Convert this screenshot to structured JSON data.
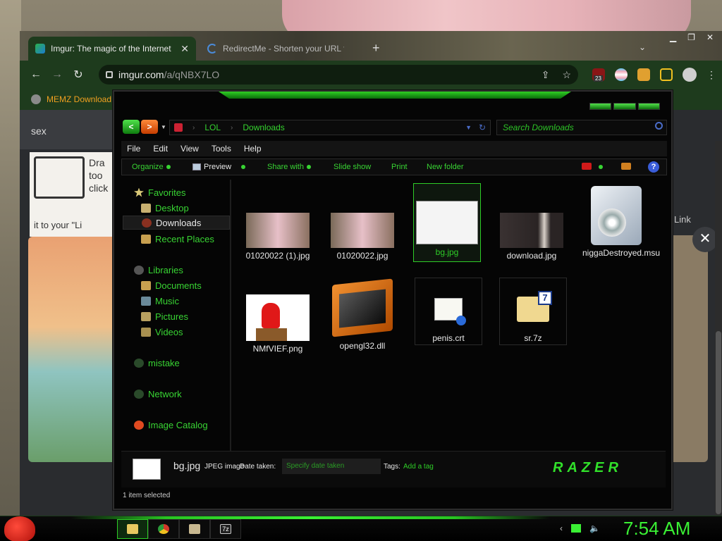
{
  "browser": {
    "tabs": [
      {
        "title": "Imgur: The magic of the Internet",
        "active": true
      },
      {
        "title": "RedirectMe - Shorten your URL f",
        "active": false
      }
    ],
    "new_tab": "+",
    "url_host": "imgur.com",
    "url_path": "/a/qNBX7LO",
    "bookmarks": [
      {
        "label": "MEMZ Download"
      }
    ],
    "extension_badge": "23"
  },
  "page": {
    "search_text": "sex",
    "card_text": "it to your \"Li",
    "card_side_text": [
      "Dra",
      "too",
      "click"
    ],
    "link_label": "Link",
    "close": "✕"
  },
  "explorer": {
    "address": [
      "LOL",
      "Downloads"
    ],
    "search_placeholder": "Search Downloads",
    "menu": [
      "File",
      "Edit",
      "View",
      "Tools",
      "Help"
    ],
    "commands": [
      "Organize",
      "Preview",
      "Share with",
      "Slide show",
      "Print",
      "New folder"
    ],
    "sidebar": {
      "favorites": "Favorites",
      "desktop": "Desktop",
      "downloads": "Downloads",
      "recent": "Recent Places",
      "libraries": "Libraries",
      "documents": "Documents",
      "music": "Music",
      "pictures": "Pictures",
      "videos": "Videos",
      "mistake": "mistake",
      "network": "Network",
      "image_catalog": "Image Catalog"
    },
    "files": [
      {
        "name": "01020022 (1).jpg",
        "kind": "anime-image"
      },
      {
        "name": "01020022.jpg",
        "kind": "anime-image"
      },
      {
        "name": "bg.jpg",
        "kind": "document-image",
        "selected": true
      },
      {
        "name": "download.jpg",
        "kind": "dark-image"
      },
      {
        "name": "niggaDestroyed.msu",
        "kind": "installer-icon"
      },
      {
        "name": "NMfVIEF.png",
        "kind": "among-us-image"
      },
      {
        "name": "opengl32.dll",
        "kind": "dll-icon"
      },
      {
        "name": "penis.crt",
        "kind": "certificate-icon"
      },
      {
        "name": "sr.7z",
        "kind": "archive-icon"
      }
    ],
    "details": {
      "name": "bg.jpg",
      "type": "JPEG image",
      "date_label": "Date taken:",
      "date_placeholder": "Specify date taken",
      "tags_label": "Tags:",
      "add_tag": "Add a tag",
      "brand": "RAZER"
    },
    "status": "1 item selected"
  },
  "taskbar": {
    "clock": "7:54 AM",
    "items": [
      "explorer",
      "chrome",
      "image-viewer",
      "7zip"
    ]
  },
  "colors": {
    "accent": "#38d433",
    "browser_green": "#1e3b1d"
  }
}
